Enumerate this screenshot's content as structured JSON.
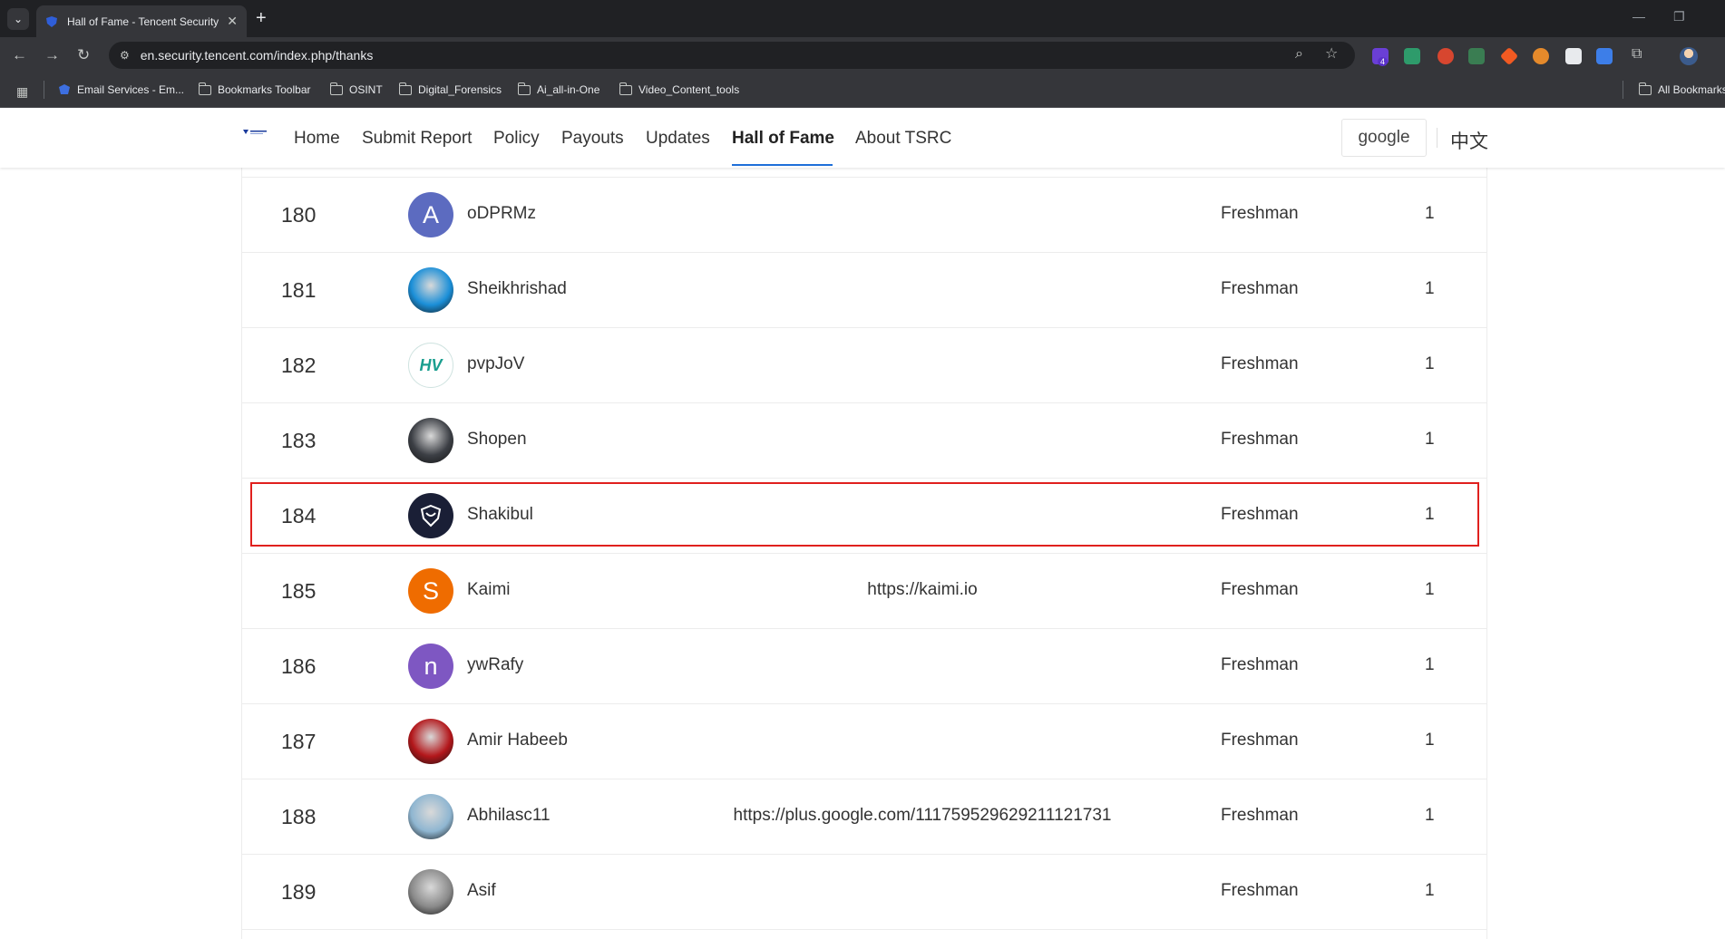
{
  "browser": {
    "tab_title": "Hall of Fame - Tencent Security",
    "url": "en.security.tencent.com/index.php/thanks",
    "extension_badge": "4",
    "bookmarks": [
      {
        "label": "Email Services - Em..."
      },
      {
        "label": "Bookmarks Toolbar"
      },
      {
        "label": "OSINT"
      },
      {
        "label": "Digital_Forensics"
      },
      {
        "label": "Ai_all-in-One"
      },
      {
        "label": "Video_Content_tools"
      }
    ],
    "all_bookmarks": "All Bookmarks"
  },
  "site": {
    "nav": [
      {
        "label": "Home"
      },
      {
        "label": "Submit Report"
      },
      {
        "label": "Policy"
      },
      {
        "label": "Payouts"
      },
      {
        "label": "Updates"
      },
      {
        "label": "Hall of Fame"
      },
      {
        "label": "About TSRC"
      }
    ],
    "active_nav": "Hall of Fame",
    "google_button": "google",
    "lang_cn": "中文"
  },
  "hall_of_fame": {
    "rows": [
      {
        "rank": "180",
        "name": "oDPRMz",
        "url": "",
        "level": "Freshman",
        "count": "1",
        "avatar": {
          "type": "letter",
          "letter": "A",
          "color": "#5c6bc0"
        }
      },
      {
        "rank": "181",
        "name": "Sheikhrishad",
        "url": "",
        "level": "Freshman",
        "count": "1",
        "avatar": {
          "type": "photo",
          "color": "#1b8fd8"
        }
      },
      {
        "rank": "182",
        "name": "pvpJoV",
        "url": "",
        "level": "Freshman",
        "count": "1",
        "avatar": {
          "type": "logo",
          "letter": "HV",
          "color": "#1a9e8f"
        }
      },
      {
        "rank": "183",
        "name": "Shopen",
        "url": "",
        "level": "Freshman",
        "count": "1",
        "avatar": {
          "type": "photo",
          "color": "#3c3f45"
        }
      },
      {
        "rank": "184",
        "name": "Shakibul",
        "url": "",
        "level": "Freshman",
        "count": "1",
        "avatar": {
          "type": "logo",
          "color": "#1a1f36"
        }
      },
      {
        "rank": "185",
        "name": "Kaimi",
        "url": "https://kaimi.io",
        "level": "Freshman",
        "count": "1",
        "avatar": {
          "type": "letter",
          "letter": "S",
          "color": "#ef6c00"
        }
      },
      {
        "rank": "186",
        "name": "ywRafy",
        "url": "",
        "level": "Freshman",
        "count": "1",
        "avatar": {
          "type": "letter",
          "letter": "n",
          "color": "#7e57c2"
        }
      },
      {
        "rank": "187",
        "name": "Amir Habeeb",
        "url": "",
        "level": "Freshman",
        "count": "1",
        "avatar": {
          "type": "photo",
          "color": "#b3171b"
        }
      },
      {
        "rank": "188",
        "name": "Abhilasc11",
        "url": "https://plus.google.com/111759529629211121731",
        "level": "Freshman",
        "count": "1",
        "avatar": {
          "type": "photo",
          "color": "#8fb6d1"
        }
      },
      {
        "rank": "189",
        "name": "Asif",
        "url": "",
        "level": "Freshman",
        "count": "1",
        "avatar": {
          "type": "photo",
          "color": "#8a8a8a"
        }
      }
    ],
    "highlight_color": "#e0201e"
  }
}
